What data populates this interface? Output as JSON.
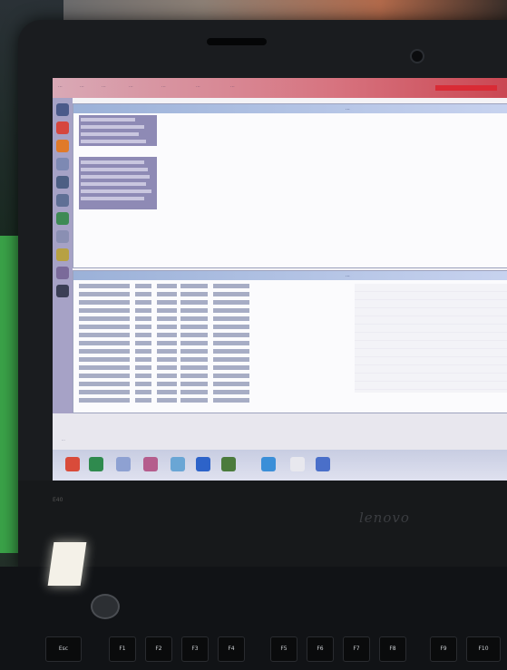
{
  "scene": {
    "brand_logo": "lenovo",
    "bezel_label": "E40",
    "screen": {
      "menu_items": [
        "...",
        "...",
        "...",
        "...",
        "...",
        "...",
        "..."
      ],
      "pane_top_caption": "...",
      "pane_bottom_caption": "...",
      "status_line": "...",
      "top_selection_rows": 14,
      "log_rows": 15
    },
    "keyboard": {
      "keys": [
        "Esc",
        "F1",
        "F2",
        "F3",
        "F4",
        "F5",
        "F6",
        "F7",
        "F8",
        "F9",
        "F10"
      ]
    },
    "colors": {
      "menubar_accent": "#d7737f",
      "selection": "#8e8ab5",
      "dock": "#a6a2c6",
      "green_wall": "#3aa248"
    }
  }
}
